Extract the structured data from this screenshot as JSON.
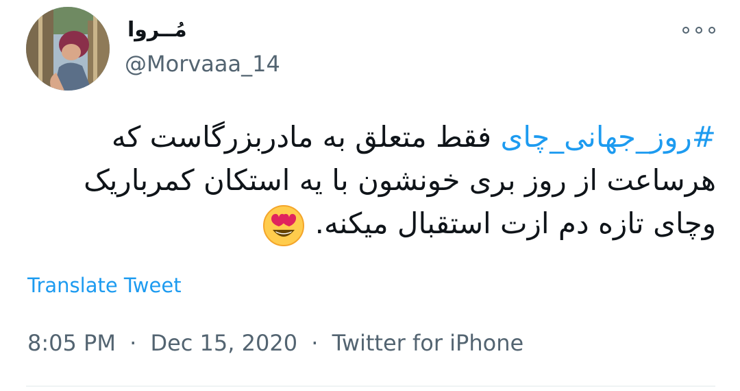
{
  "author": {
    "display_name": "مُــروا",
    "handle": "@Morvaaa_14"
  },
  "tweet": {
    "hashtag": "#روز_جهانی_چای",
    "text": "فقط متعلق به مادربزرگاست که هرساعت از روز بری خونشون با یه استکان کمرباریک وچای تازه دم ازت استقبال میکنه.",
    "emoji": "heart-eyes-emoji"
  },
  "actions": {
    "more": "more-options-icon",
    "translate_label": "Translate Tweet"
  },
  "meta": {
    "time": "8:05 PM",
    "separator": "·",
    "date": "Dec 15, 2020",
    "source": "Twitter for iPhone"
  },
  "colors": {
    "link": "#1d9bf0",
    "secondary_text": "#536471",
    "primary_text": "#0f1419",
    "divider": "#eff3f4"
  }
}
